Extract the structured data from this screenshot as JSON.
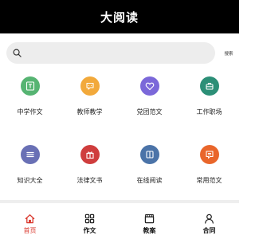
{
  "header": {
    "title": "大阅读"
  },
  "search": {
    "value": "",
    "placeholder": "",
    "button_label": "搜索"
  },
  "categories": [
    {
      "label": "中学作文",
      "icon": "document-t-icon",
      "color": "#56b472"
    },
    {
      "label": "教师教学",
      "icon": "chat-bubble-icon",
      "color": "#f2a93b"
    },
    {
      "label": "党团范文",
      "icon": "heart-shield-icon",
      "color": "#7b68d9"
    },
    {
      "label": "工作职场",
      "icon": "briefcase-icon",
      "color": "#2c8f77"
    },
    {
      "label": "知识大全",
      "icon": "list-icon",
      "color": "#6970b5"
    },
    {
      "label": "法律文书",
      "icon": "gift-icon",
      "color": "#cf3d3d"
    },
    {
      "label": "在线阅读",
      "icon": "book-icon",
      "color": "#4b73a8"
    },
    {
      "label": "常用范文",
      "icon": "message-icon",
      "color": "#e9662b"
    }
  ],
  "tabbar": {
    "tabs": [
      {
        "label": "首页",
        "icon": "home-icon",
        "active": true
      },
      {
        "label": "作文",
        "icon": "grid-icon",
        "active": false
      },
      {
        "label": "教案",
        "icon": "clapperboard-icon",
        "active": false
      },
      {
        "label": "合同",
        "icon": "person-icon",
        "active": false
      }
    ],
    "active_color": "#d9362b"
  }
}
